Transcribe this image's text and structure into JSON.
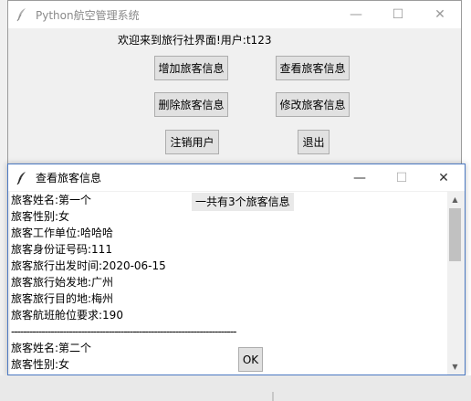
{
  "main_window": {
    "title": "Python航空管理系统",
    "welcome_text": "欢迎来到旅行社界面!用户:t123",
    "buttons": {
      "add": "增加旅客信息",
      "view": "查看旅客信息",
      "delete": "删除旅客信息",
      "modify": "修改旅客信息",
      "logout": "注销用户",
      "exit": "退出"
    }
  },
  "dialog": {
    "title": "查看旅客信息",
    "count_label": "一共有3个旅客信息",
    "lines": [
      "旅客姓名:第一个",
      "旅客性别:女",
      "旅客工作单位:哈哈哈",
      "旅客身份证号码:111",
      "旅客旅行出发时间:2020-06-15",
      "旅客旅行始发地:广州",
      "旅客旅行目的地:梅州",
      "旅客航班舱位要求:190",
      "--------------------------------------------------------------------------",
      "旅客姓名:第二个",
      "旅客性别:女"
    ],
    "ok_label": "OK"
  },
  "window_controls": {
    "minimize_icon": "minimize-icon",
    "maximize_icon": "maximize-icon",
    "close_icon": "close-icon"
  },
  "colors": {
    "window_bg": "#f0f0f0",
    "button_bg": "#e1e1e1",
    "dialog_border": "#4a78c2"
  }
}
